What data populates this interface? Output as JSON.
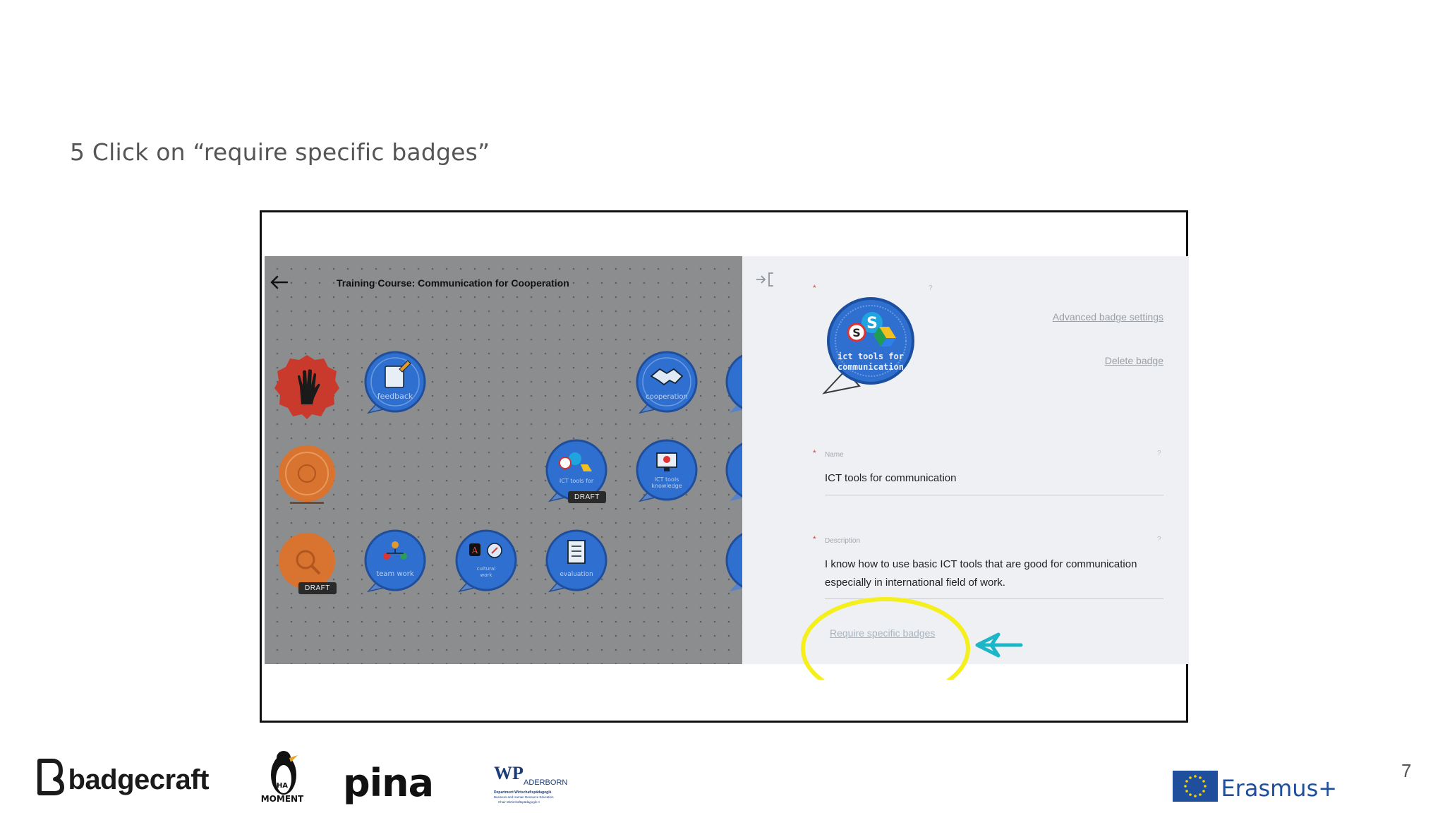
{
  "slide": {
    "title": "5 Click on “require specific badges”",
    "page_number": "7"
  },
  "left_panel": {
    "course_title": "Training Course: Communication for Cooperation",
    "badges": [
      {
        "label": "feedback",
        "icon": "pencil-paper-icon"
      },
      {
        "label": "cooperation",
        "icon": "handshake-icon"
      },
      {
        "label": "ICT tools for communication",
        "icon": "skype-drive-icon",
        "status": "DRAFT"
      },
      {
        "label": "ICT tools knowledge",
        "icon": "computer-icon"
      },
      {
        "label": "team work",
        "icon": "team-icon"
      },
      {
        "label": "cultural work",
        "icon": "compass-icon"
      },
      {
        "label": "evaluation",
        "icon": "checklist-icon"
      }
    ],
    "draft_label": "DRAFT"
  },
  "right_panel": {
    "badge_caption_line1": "ict tools for",
    "badge_caption_line2": "communication",
    "advanced_link": "Advanced badge settings",
    "delete_link": "Delete badge",
    "name_label": "Name",
    "name_value": "ICT tools for communication",
    "description_label": "Description",
    "description_line1": "I know how to use basic ICT tools that are good for communication",
    "description_line2": "especially in international field of work.",
    "require_link": "Require specific badges",
    "help_mark": "?"
  },
  "footer": {
    "badgecraft": "badgecraft",
    "ha_moment_line1": "HA",
    "ha_moment_line2": "MOMENT",
    "pina": "pina",
    "wp_main": "WP",
    "wp_aderborn": "ADERBORN",
    "wp_line1": "Department Wirtschaftspädagogik",
    "wp_line2": "Business and Human Resource Education",
    "wp_line3": "Chair Wirtschaftspädagogik II",
    "erasmus": "Erasmus+"
  },
  "colors": {
    "highlight_circle": "#f5ef1d",
    "arrow": "#1bb7c9",
    "badge_blue": "#2f6fcf",
    "eu_blue": "#1f4e9c",
    "eu_star": "#f5d300"
  }
}
